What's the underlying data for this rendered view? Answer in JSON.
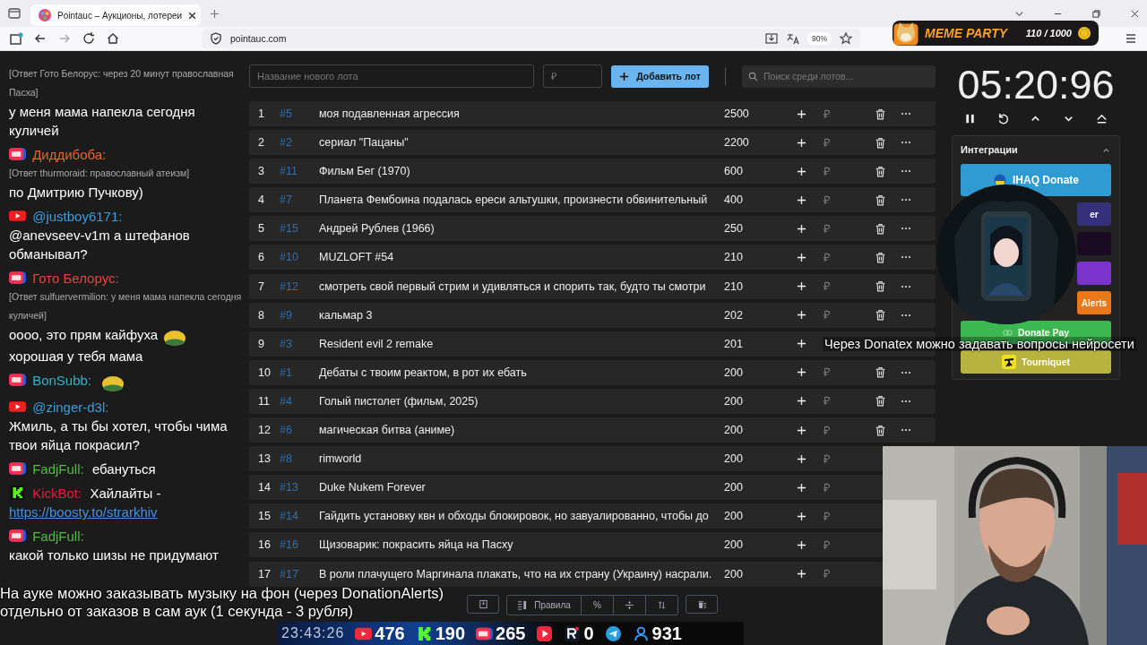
{
  "browser": {
    "tab_title": "Pointauc – Аукционы, лотереи",
    "url": "pointauc.com",
    "zoom": "90%"
  },
  "meme_party": {
    "title": "MEME PARTY",
    "progress": "110 / 1000"
  },
  "chat": [
    {
      "reply": "[Ответ Гото Белорус: через 20 минут православная Пасха]",
      "parts": [
        {
          "kind": "text",
          "text": "у меня мама напекла сегодня куличей"
        }
      ]
    },
    {
      "kind": "vklive",
      "name": "Диддибоба:",
      "color": "#e06a2a",
      "reply": "[Ответ thurmoraid: православный атеизм]",
      "parts": [
        {
          "kind": "text",
          "text": "по Дмитрию Пучкову)"
        }
      ]
    },
    {
      "kind": "youtube",
      "name": "@justboy6171:",
      "color": "#3a9ee0",
      "parts": [
        {
          "kind": "text",
          "text": "@anevseev-v1m а штефанов обманывал?"
        }
      ]
    },
    {
      "kind": "vklive",
      "name": "Гото Белорус:",
      "color": "#e04a3c",
      "reply": "[Ответ sulfuervermilion: у меня мама напекла сегодня куличей]",
      "parts": [
        {
          "kind": "text",
          "text": "оооо, это прям кайфуха"
        },
        {
          "kind": "emote"
        },
        {
          "kind": "text",
          "text": "хорошая у тебя мама"
        }
      ]
    },
    {
      "kind": "vklive",
      "name": "BonSubb:",
      "color": "#38b0c8",
      "parts": [
        {
          "kind": "emote"
        }
      ]
    },
    {
      "kind": "youtube",
      "name": "@zinger-d3l:",
      "color": "#3a9ee0",
      "parts": [
        {
          "kind": "text",
          "text": "Жмиль, а ты бы хотел, чтобы чима твои яйца покрасил?"
        }
      ]
    },
    {
      "kind": "vklive",
      "name": "FadjFull:",
      "color": "#4cbf3c",
      "parts": [
        {
          "kind": "text",
          "text": "ебануться"
        }
      ]
    },
    {
      "kind": "kick",
      "name": "KickBot:",
      "color": "#e0203c",
      "parts": [
        {
          "kind": "text",
          "text": "Хайлайты -"
        },
        {
          "kind": "link",
          "text": "https://boosty.to/strarkhiv"
        }
      ]
    },
    {
      "kind": "vklive",
      "name": "FadjFull:",
      "color": "#4cbf3c",
      "parts": [
        {
          "kind": "text",
          "text": "какой только шизы не придумают"
        }
      ]
    }
  ],
  "toolbar": {
    "name_placeholder": "Название нового лота",
    "amount_placeholder": "₽",
    "add_button": "Добавить лот",
    "search_placeholder": "Поиск среди лотов..."
  },
  "lots": [
    {
      "index": "1",
      "id": "#5",
      "name": "моя подавленная агрессия",
      "amount": "2500"
    },
    {
      "index": "2",
      "id": "#2",
      "name": "сериал \"Пацаны\"",
      "amount": "2200"
    },
    {
      "index": "3",
      "id": "#11",
      "name": "Фильм Бег (1970)",
      "amount": "600"
    },
    {
      "index": "4",
      "id": "#7",
      "name": "Планета Фембоина подалась ереси альтушки, произнести обвинительный",
      "amount": "400"
    },
    {
      "index": "5",
      "id": "#15",
      "name": "Андрей Рублев (1966)",
      "amount": "250"
    },
    {
      "index": "6",
      "id": "#10",
      "name": "MUZLOFT #54",
      "amount": "210"
    },
    {
      "index": "7",
      "id": "#12",
      "name": "смотреть свой первый стрим и удивляться и спорить так, будто ты смотри",
      "amount": "210"
    },
    {
      "index": "8",
      "id": "#9",
      "name": "кальмар 3",
      "amount": "202"
    },
    {
      "index": "9",
      "id": "#3",
      "name": "Resident evil 2 remake",
      "amount": "201"
    },
    {
      "index": "10",
      "id": "#1",
      "name": "Дебаты с твоим реактом, в рот их ебать",
      "amount": "200"
    },
    {
      "index": "11",
      "id": "#4",
      "name": "Голый пистолет (фильм, 2025)",
      "amount": "200"
    },
    {
      "index": "12",
      "id": "#6",
      "name": "магическая битва (аниме)",
      "amount": "200"
    },
    {
      "index": "13",
      "id": "#8",
      "name": "rimworld",
      "amount": "200"
    },
    {
      "index": "14",
      "id": "#13",
      "name": "Duke Nukem Forever",
      "amount": "200"
    },
    {
      "index": "15",
      "id": "#14",
      "name": "Гайдить установку квн и обходы блокировок, но завуалированно, чтобы до",
      "amount": "200"
    },
    {
      "index": "16",
      "id": "#16",
      "name": "Щизоварик: покрасить яйца на Пасху",
      "amount": "200"
    },
    {
      "index": "17",
      "id": "#17",
      "name": "В роли плачущего Маргинала плакать, что на их страну (Украину) насрали.",
      "amount": "200"
    }
  ],
  "bottom_toolbar": {
    "rules_button": "Правила",
    "percent_button": "%"
  },
  "timer": {
    "time": "05:20:96"
  },
  "integrations": {
    "title": "Интеграции",
    "expanded": true,
    "buttons": [
      {
        "kind": "ihaq",
        "label": "IHAQ Donate",
        "color": "#2f9bd2"
      },
      {
        "kind": "plain",
        "label": "er",
        "color": "#34307a"
      },
      {
        "kind": "plain",
        "color": "#1a0a22"
      },
      {
        "kind": "plain",
        "color": "#7a34cc"
      },
      {
        "kind": "plain",
        "label": "Alerts",
        "color": "#e8781a"
      },
      {
        "kind": "donatepay",
        "label": "Donate Pay",
        "color": "#3cb850"
      },
      {
        "kind": "tourniquet",
        "label": "Tourniquet",
        "color": "#b8b23e"
      }
    ]
  },
  "overlay_caption": {
    "lines": [
      "На ауке можно заказывать музыку на фон (через DonationAlerts)",
      "отдельно от заказов в сам аук (1 секунда - 3 рубля)"
    ]
  },
  "overlay_ticker": "Через Donatex можно задавать вопросы нейросети",
  "stats_bar": {
    "clock": "23:43:26",
    "items": [
      {
        "kind": "youtube",
        "count": "476"
      },
      {
        "kind": "kick",
        "count": "190"
      },
      {
        "kind": "vklive",
        "count": "265"
      },
      {
        "kind": "play"
      },
      {
        "kind": "rutube",
        "count": "0"
      },
      {
        "kind": "telegram"
      },
      {
        "kind": "viewers",
        "count": "931"
      }
    ]
  }
}
